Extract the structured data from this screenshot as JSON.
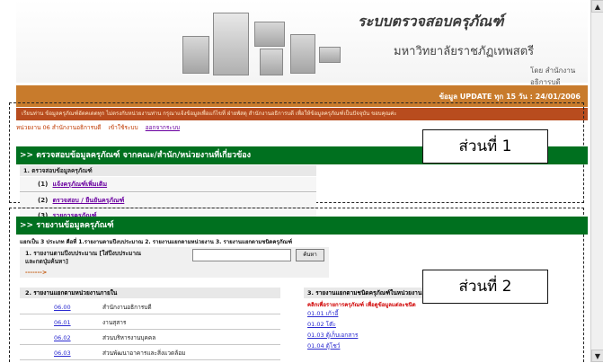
{
  "header": {
    "system_title": "ระบบตรวจสอบครุภัณฑ์",
    "university": "มหาวิทยาลัยราชภัฏเทพสตรี",
    "department": "โดย สำนักงานอธิการบดี",
    "update_text": "ข้อมูล UPDATE ทุก 15 วัน : 24/01/2006",
    "notice": "เรียนท่าน ข้อมูลครุภัณฑ์อัตคเดตทุก ไม่ตรงกับหน่วยงานท่าน กรุณาแจ้งข้อมูลเพื่อแก้ไขที่ ฝ่ายพัสดุ สำนักงานอธิการบดี เพื่อให้ข้อมูลครุภัณฑ์เป็นปัจจุบัน ขอบคุณค่ะ"
  },
  "nav": {
    "dept": "หน่วยงาน 06  สำนักงานอธิการบดี",
    "user": "เข้าใช้ระบบ",
    "logout": "ออกจากระบบ"
  },
  "section1": {
    "title": ">> ตรวจสอบข้อมูลครุภัณฑ์ จากคณะ/สำนัก/หน่วยงานที่เกี่ยวข้อง",
    "subheader": "1. ตรวจสอบข้อมูลครุภัณฑ์",
    "items": [
      {
        "num": "(1)",
        "label": "แจ้งครุภัณฑ์เพิ่มเติม"
      },
      {
        "num": "(2)",
        "label": "ตรวจสอบ / ยืนยันครุภัณฑ์"
      },
      {
        "num": "(3)",
        "label": "รายการครุภัณฑ์"
      }
    ],
    "annotation": "ส่วนที่ 1"
  },
  "section2": {
    "title": ">> รายงานข้อมูลครุภัณฑ์",
    "description": "แยกเป็น 3 ประเภท คือที่ 1.รายงานตามปีงบประมาณ  2. รายงานแยกตามหน่วยงาน  3. รายงานแยกตามชนิดครุภัณฑ์",
    "year_label": "1. รายงานตามปีงบประมาณ [ใส่ปีงบประมาณ และกดปุ่มค้นหา]",
    "year_arrow": "------->",
    "search_button": "ค้นหา",
    "dept_header": "2. รายงานแยกตามหน่วยงานภายใน",
    "type_header": "3. รายงานแยกตามชนิดครุภัณฑ์ในหน่วยงาน",
    "type_hint": "คลิกเพื่อรายการครุภัณฑ์ เพื่อดูข้อมูลแต่ละชนิด",
    "departments": [
      {
        "code": "06.00",
        "name": "สำนักงานอธิการบดี"
      },
      {
        "code": "06.01",
        "name": "งานสุสาร"
      },
      {
        "code": "06.02",
        "name": "ส่วนบริหารงานบุคคล"
      },
      {
        "code": "06.03",
        "name": "ส่วนพัฒนาอาคารและสิ่งแวดล้อม"
      }
    ],
    "types": [
      {
        "label": "01.01 เก้าอี้"
      },
      {
        "label": "01.02 โต๊ะ"
      },
      {
        "label": "01.03 ตู้เก็บเอกสาร"
      },
      {
        "label": "01.04 ตู้โชว์"
      }
    ],
    "annotation": "ส่วนที่ 2"
  }
}
